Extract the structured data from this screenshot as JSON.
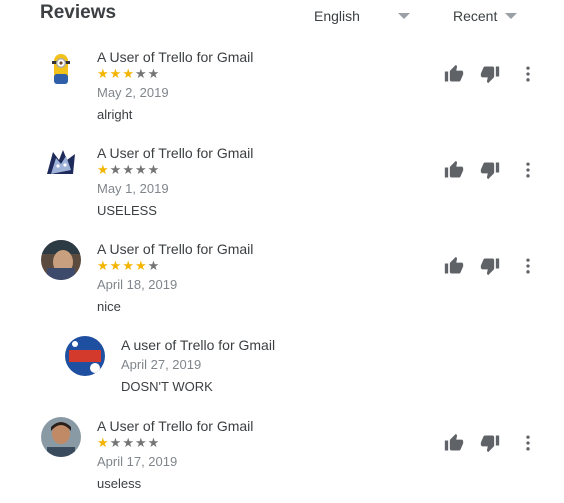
{
  "header": {
    "title": "Reviews",
    "language_label": "English",
    "sort_label": "Recent"
  },
  "reviews": [
    {
      "author": "A User of Trello for Gmail",
      "rating": 3,
      "rating_max": 5,
      "date": "May 2, 2019",
      "text": "alright",
      "avatar": "minion-avatar"
    },
    {
      "author": "A User of Trello for Gmail",
      "rating": 1,
      "rating_max": 5,
      "date": "May 1, 2019",
      "text": "USELESS",
      "avatar": "wolf-avatar"
    },
    {
      "author": "A User of Trello for Gmail",
      "rating": 4,
      "rating_max": 5,
      "date": "April 18, 2019",
      "text": "nice",
      "avatar": "photo-avatar"
    }
  ],
  "reply": {
    "author": "A user of Trello for Gmail",
    "date": "April 27, 2019",
    "text": "DOSN'T WORK",
    "avatar": "star-wars-avatar"
  },
  "review4": {
    "author": "A User of Trello for Gmail",
    "rating": 1,
    "rating_max": 5,
    "date": "April 17, 2019",
    "text": "useless",
    "avatar": "person-avatar"
  },
  "colors": {
    "star_filled": "#f4b400",
    "star_empty": "#757575",
    "icon": "#5f6368"
  }
}
